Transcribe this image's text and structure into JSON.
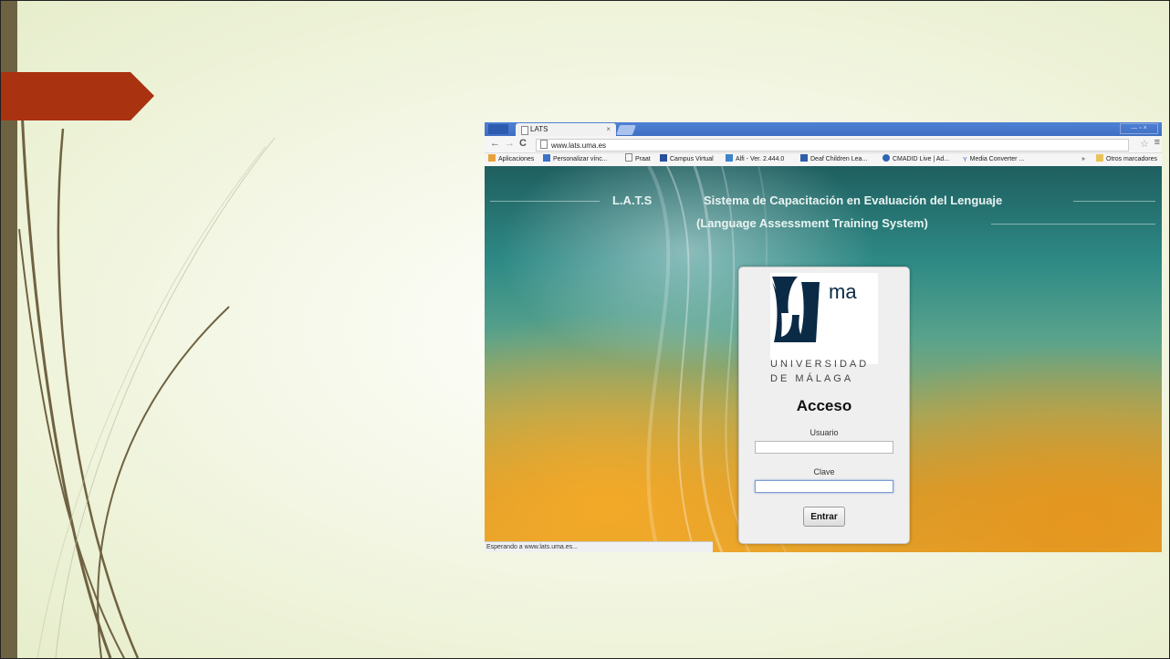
{
  "browser": {
    "tab_title": "LATS",
    "tab_close": "×",
    "url": "www.lats.uma.es",
    "window_controls": "— ▫ ×",
    "bookmarks": [
      "Aplicaciones",
      "Personalizar vínc...",
      "Praat",
      "Campus Virtual",
      "Alfi - Ver. 2.444.0",
      "Deaf Children Lea...",
      "CMADID Live | Ad...",
      "Media Converter ..."
    ],
    "bookmarks_more": "»",
    "other_bookmarks": "Otros marcadores",
    "status_text": "Esperando a www.lats.uma.es..."
  },
  "page": {
    "brand": "L.A.T.S",
    "title_es": "Sistema de Capacitación en Evaluación del Lenguaje",
    "title_en": "(Language Assessment Training System)"
  },
  "login": {
    "logo_text": "ma",
    "university_line1": "UNIVERSIDAD",
    "university_line2": "DE MÁLAGA",
    "heading": "Acceso",
    "user_label": "Usuario",
    "user_value": "",
    "password_label": "Clave",
    "password_value": "",
    "submit_label": "Entrar"
  },
  "icons": [
    "back-icon",
    "forward-icon",
    "reload-icon",
    "page-icon",
    "star-icon",
    "menu-icon",
    "apps-icon",
    "folder-icon"
  ],
  "colors": {
    "accent_red": "#a93211",
    "side_bar": "#6d6342",
    "chrome_blue": "#4f81d4",
    "logo_navy": "#0b2a45"
  }
}
